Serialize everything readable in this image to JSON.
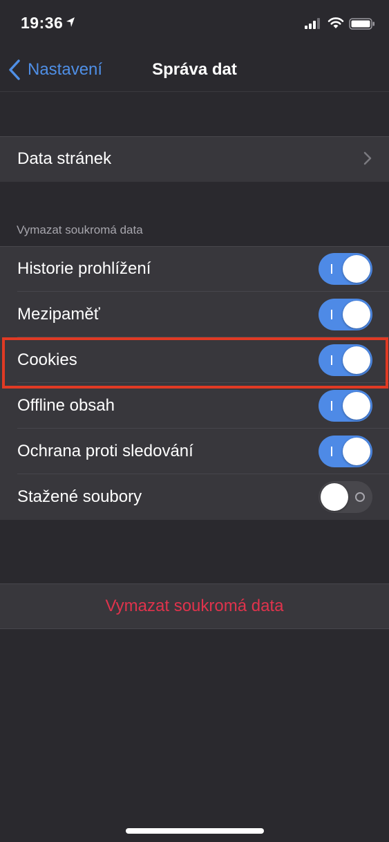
{
  "status_bar": {
    "time": "19:36",
    "icons": [
      "location-arrow-icon",
      "cellular-signal-icon",
      "wifi-icon",
      "battery-icon"
    ]
  },
  "nav": {
    "back_label": "Nastavení",
    "title": "Správa dat"
  },
  "website_data": {
    "label": "Data stránek"
  },
  "clear_section": {
    "header": "Vymazat soukromá data",
    "items": [
      {
        "label": "Historie prohlížení",
        "on": true
      },
      {
        "label": "Mezipaměť",
        "on": true
      },
      {
        "label": "Cookies",
        "on": true,
        "highlighted": true
      },
      {
        "label": "Offline obsah",
        "on": true
      },
      {
        "label": "Ochrana proti sledování",
        "on": true
      },
      {
        "label": "Stažené soubory",
        "on": false
      }
    ]
  },
  "clear_button": {
    "label": "Vymazat soukromá data"
  },
  "colors": {
    "background": "#2a292e",
    "cell": "#38373c",
    "accent_blue": "#4e8ae6",
    "destructive_red": "#e0334c",
    "highlight_red": "#e03a24"
  }
}
